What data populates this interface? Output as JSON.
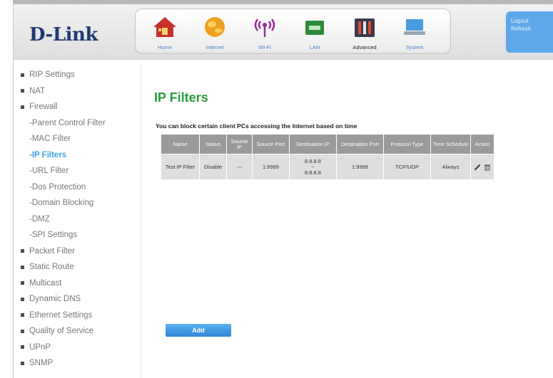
{
  "brand": {
    "logo_text": "D-Link"
  },
  "nav": {
    "items": [
      {
        "label": "Home",
        "icon": "home-icon"
      },
      {
        "label": "Internet",
        "icon": "globe-icon"
      },
      {
        "label": "Wi-Fi",
        "icon": "wifi-icon"
      },
      {
        "label": "LAN",
        "icon": "lan-icon"
      },
      {
        "label": "Advanced",
        "icon": "advanced-tools-icon"
      },
      {
        "label": "System",
        "icon": "system-laptop-icon"
      }
    ]
  },
  "session": {
    "logout_label": "Logout",
    "refresh_label": "Refresh"
  },
  "sidebar": {
    "items": [
      {
        "label": "RIP Settings"
      },
      {
        "label": "NAT"
      },
      {
        "label": "Firewall"
      },
      {
        "label": "-Parent Control Filter"
      },
      {
        "label": "-MAC Filter"
      },
      {
        "label": "-IP Filters"
      },
      {
        "label": "-URL Filter"
      },
      {
        "label": "-Dos Protection"
      },
      {
        "label": "-Domain Blocking"
      },
      {
        "label": "-DMZ"
      },
      {
        "label": "-SPI Settings"
      },
      {
        "label": "Packet Filter"
      },
      {
        "label": "Static Route"
      },
      {
        "label": "Multicast"
      },
      {
        "label": "Dynamic DNS"
      },
      {
        "label": "Ethernet Settings"
      },
      {
        "label": "Quality of Service"
      },
      {
        "label": "UPnP"
      },
      {
        "label": "SNMP"
      }
    ]
  },
  "main": {
    "title": "IP Filters",
    "subtitle": "You can block certain client PCs accessing the Internet based on time",
    "table": {
      "headers": [
        "Name",
        "Status",
        "Source IP",
        "Source Port",
        "Destination IP",
        "Destination Port",
        "Protocol Type",
        "Time Schedule",
        "Action"
      ],
      "rows": [
        {
          "name": "Test IP Filter",
          "status": "Disable",
          "source_ip": "---",
          "source_port": "1:9999",
          "dest_ip_start": "8.8.8.8",
          "dest_ip_sep": "~",
          "dest_ip_end": "8.8.8.8",
          "dest_port": "1:9999",
          "protocol": "TCP/UDP",
          "schedule": "Always"
        }
      ]
    },
    "add_label": "Add"
  },
  "colors": {
    "accent": "#2a9d3e",
    "active_link": "#3ba3e0",
    "button": "#3a8fd8",
    "header_cell": "#9a9a9a"
  }
}
